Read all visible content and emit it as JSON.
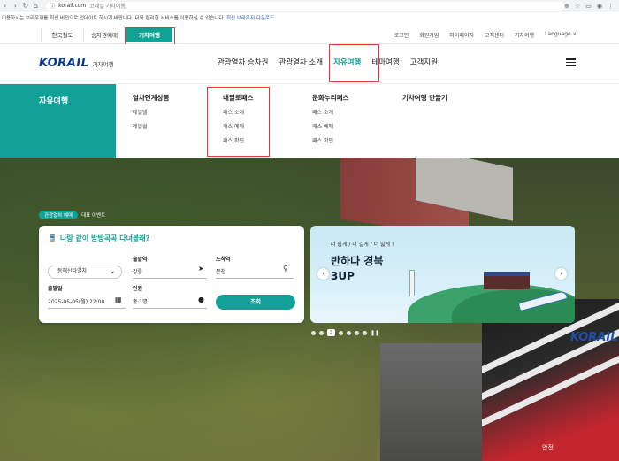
{
  "browser": {
    "url": "korail.com",
    "tab_title": "코레일 기차여행"
  },
  "notice": {
    "text": "이용하시는 브라우저를 최신 버전으로 업데이트 하시기 바랍니다. 더욱 편리한 서비스를 이용하실 수 있습니다.",
    "link": "최신 브라우저 다운로드"
  },
  "util": {
    "site_tabs": [
      "한국철도",
      "승차권예매",
      "기차여행"
    ],
    "links": [
      "로그인",
      "회원가입",
      "마이페이지",
      "고객센터",
      "기차여행",
      "Language ∨"
    ]
  },
  "header": {
    "logo": "KORAIL",
    "logo_sub": "기차여행",
    "gnb": [
      "관광열차 승차권",
      "관광열차 소개",
      "자유여행",
      "테마여행",
      "고객지원"
    ],
    "active_index": 2
  },
  "mega": {
    "section_title": "자유여행",
    "columns": [
      {
        "title": "열차연계상품",
        "items": [
          "레일텔",
          "레일쉽"
        ]
      },
      {
        "title": "내일로패스",
        "items": [
          "패스 소개",
          "패스 예매",
          "패스 확인"
        ]
      },
      {
        "title": "문화누리패스",
        "items": [
          "패스 소개",
          "패스 예매",
          "패스 확인"
        ]
      },
      {
        "title": "기차여행 만들기",
        "items": []
      }
    ]
  },
  "booking": {
    "chip_active": "관광열차 예매",
    "chip_other": "대표 이벤트",
    "heading": "나랑 같이 방방곡곡 다녀볼래?",
    "train_select": "동해산타열차",
    "departure_label": "출발역",
    "departure_value": "강릉",
    "arrival_label": "도착역",
    "arrival_value": "분천",
    "date_label": "출발일",
    "date_value": "2025-05-05(월) 22:00",
    "people_label": "인원",
    "people_value": "총 1명",
    "search_button": "조회"
  },
  "promo": {
    "small": "더 쉽게 / 더 길게 / 더 넓게 !",
    "big_line1": "반하다 경북",
    "big_line2": "3UP",
    "current_slide": "3"
  },
  "hero": {
    "loco_brand": "KORAIL",
    "loco_warning": "안전"
  },
  "colors": {
    "accent": "#12a197",
    "highlight": "#e53935",
    "logo": "#0b3a8a"
  }
}
